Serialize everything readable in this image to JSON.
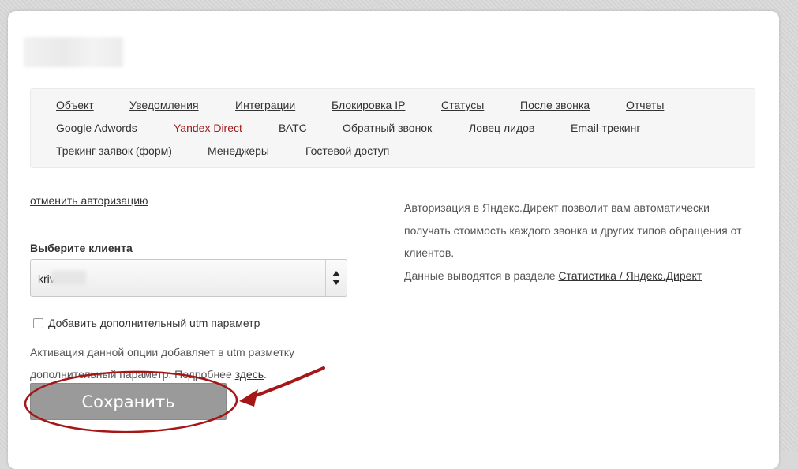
{
  "nav": {
    "rows": [
      [
        "Объект",
        "Уведомления",
        "Интеграции",
        "Блокировка IP",
        "Статусы",
        "После звонка",
        "Отчеты"
      ],
      [
        "Google Adwords",
        "Yandex Direct",
        "ВАТС",
        "Обратный звонок",
        "Ловец лидов",
        "Email-трекинг"
      ],
      [
        "Трекинг заявок (форм)",
        "Менеджеры",
        "Гостевой доступ"
      ]
    ],
    "active": "Yandex Direct",
    "active_color": "#a01b1b"
  },
  "auth": {
    "cancel_label": "отменить авторизацию"
  },
  "client_select": {
    "label": "Выберите клиента",
    "value": "kriv"
  },
  "utm_option": {
    "checkbox_label": "Добавить дополнительный utm параметр",
    "checked": false,
    "help_text": "Активация данной опции добавляет в utm разметку дополнительный параметр. Подробнее",
    "help_link": "здесь",
    "help_end": "."
  },
  "save_button": {
    "label": "Сохранить"
  },
  "info": {
    "text": "Авторизация в Яндекс.Директ позволит вам автоматически получать стоимость каждого звонка и других типов обращения от клиентов.",
    "output_prefix": "Данные выводятся в разделе",
    "output_link": "Статистика / Яндекс.Директ"
  },
  "annotation_color": "#a51616"
}
